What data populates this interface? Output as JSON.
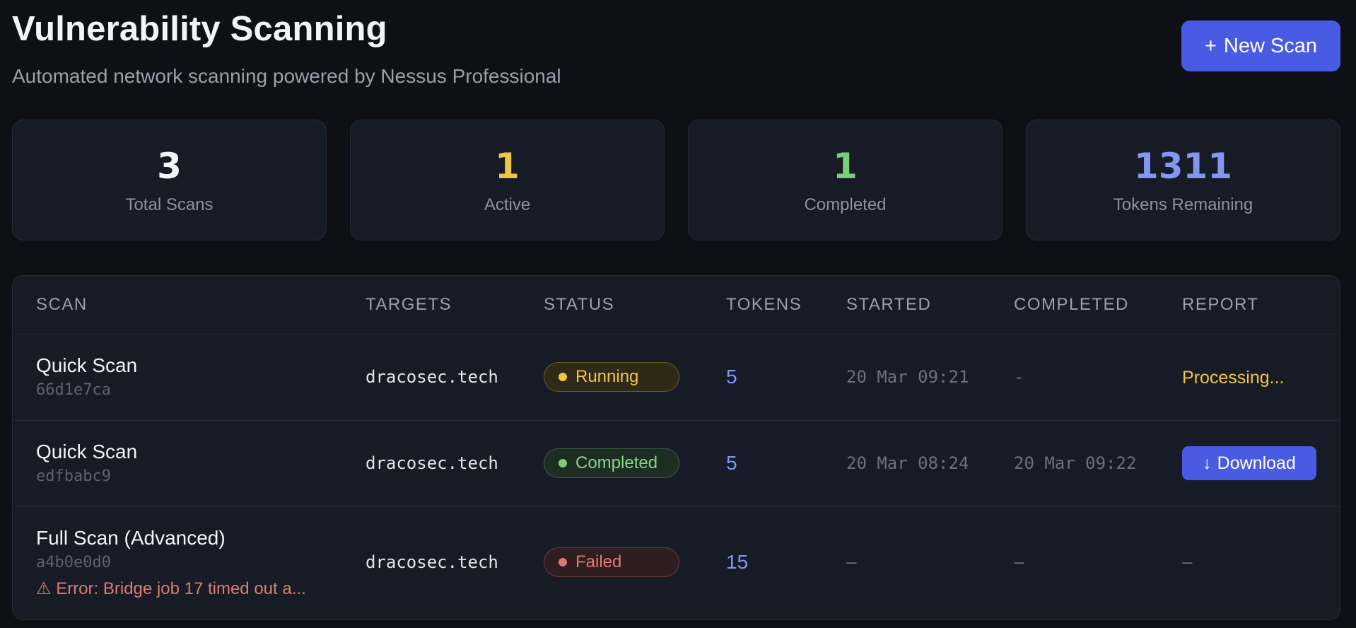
{
  "header": {
    "title": "Vulnerability Scanning",
    "subtitle": "Automated network scanning powered by Nessus Professional",
    "new_scan_icon": "+",
    "new_scan_label": "New Scan"
  },
  "stats": [
    {
      "value": "3",
      "label": "Total Scans",
      "color": "#f3f4f7"
    },
    {
      "value": "1",
      "label": "Active",
      "color": "#f0c542"
    },
    {
      "value": "1",
      "label": "Completed",
      "color": "#79d07b"
    },
    {
      "value": "1311",
      "label": "Tokens Remaining",
      "color": "#8296f2"
    }
  ],
  "table": {
    "columns": [
      "SCAN",
      "TARGETS",
      "STATUS",
      "TOKENS",
      "STARTED",
      "COMPLETED",
      "REPORT"
    ],
    "rows": [
      {
        "name": "Quick Scan",
        "id": "66d1e7ca",
        "target": "dracosec.tech",
        "status": "Running",
        "tokens": "5",
        "started": "20 Mar 09:21",
        "completed": "-",
        "report": "Processing..."
      },
      {
        "name": "Quick Scan",
        "id": "edfbabc9",
        "target": "dracosec.tech",
        "status": "Completed",
        "tokens": "5",
        "started": "20 Mar 08:24",
        "completed": "20 Mar 09:22",
        "report_icon": "↓",
        "report": "Download"
      },
      {
        "name": "Full Scan (Advanced)",
        "id": "a4b0e0d0",
        "error_icon": "⚠",
        "error": "Error: Bridge job 17 timed out a...",
        "target": "dracosec.tech",
        "status": "Failed",
        "tokens": "15",
        "started": "—",
        "completed": "—",
        "report": "—"
      }
    ]
  },
  "colors": {
    "background": "#0e1016",
    "card": "#171b25",
    "accent": "#4a5be3",
    "running": "#f0c542",
    "completed": "#79d07b",
    "failed": "#e07a6e",
    "tokens": "#8296f2"
  }
}
